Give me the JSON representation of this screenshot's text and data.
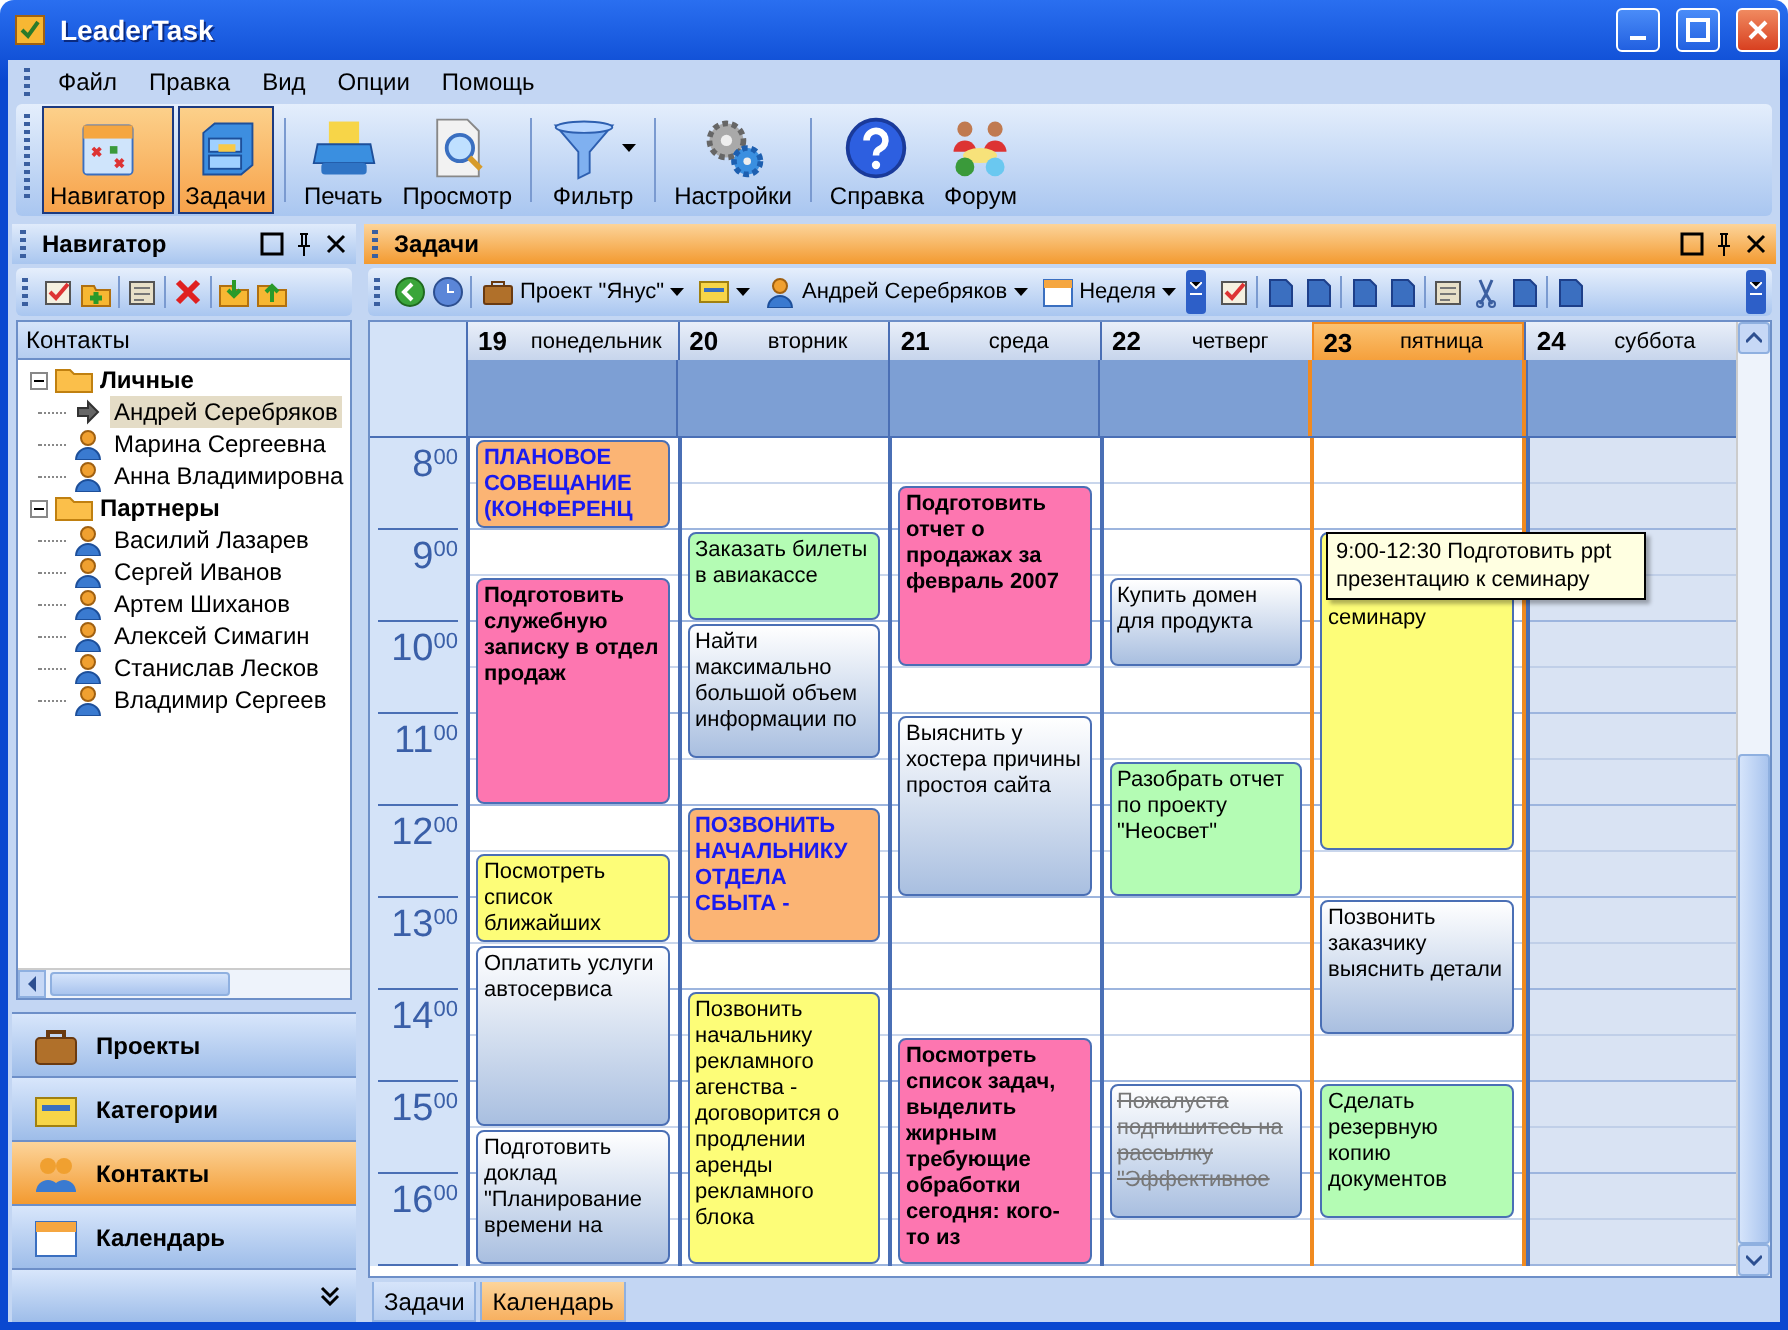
{
  "window": {
    "title": "LeaderTask"
  },
  "menu": [
    "Файл",
    "Правка",
    "Вид",
    "Опции",
    "Помощь"
  ],
  "toolbar": [
    {
      "label": "Навигатор",
      "selected": true,
      "dropdown": false
    },
    {
      "label": "Задачи",
      "selected": true,
      "dropdown": false
    },
    {
      "label": "Печать",
      "selected": false,
      "dropdown": false
    },
    {
      "label": "Просмотр",
      "selected": false,
      "dropdown": false
    },
    {
      "label": "Фильтр",
      "selected": false,
      "dropdown": true
    },
    {
      "label": "Настройки",
      "selected": false,
      "dropdown": false
    },
    {
      "label": "Справка",
      "selected": false,
      "dropdown": false
    },
    {
      "label": "Форум",
      "selected": false,
      "dropdown": false
    }
  ],
  "navigator": {
    "title": "Навигатор",
    "tree_header": "Контакты",
    "tree": [
      {
        "label": "Личные",
        "expanded": true,
        "children": [
          {
            "label": "Андрей Серебряков",
            "selected": true
          },
          {
            "label": "Марина Сергеевна",
            "selected": false
          },
          {
            "label": "Анна Владимировна",
            "selected": false
          }
        ]
      },
      {
        "label": "Партнеры",
        "expanded": true,
        "children": [
          {
            "label": "Василий Лазарев",
            "selected": false
          },
          {
            "label": "Сергей Иванов",
            "selected": false
          },
          {
            "label": "Артем Шиханов",
            "selected": false
          },
          {
            "label": "Алексей Симагин",
            "selected": false
          },
          {
            "label": "Станислав Лесков",
            "selected": false
          },
          {
            "label": "Владимир Сергеев",
            "selected": false
          }
        ]
      }
    ],
    "sections": [
      {
        "label": "Проекты",
        "selected": false
      },
      {
        "label": "Категории",
        "selected": false
      },
      {
        "label": "Контакты",
        "selected": true
      },
      {
        "label": "Календарь",
        "selected": false
      }
    ]
  },
  "tasks": {
    "title": "Задачи",
    "filters": [
      {
        "label": "Проект \"Янус\""
      },
      {
        "label": "Андрей Серебряков"
      },
      {
        "label": "Неделя"
      }
    ],
    "calendar": {
      "hours": [
        {
          "hour": "8",
          "minutes": "00"
        },
        {
          "hour": "9",
          "minutes": "00"
        },
        {
          "hour": "10",
          "minutes": "00"
        },
        {
          "hour": "11",
          "minutes": "00"
        },
        {
          "hour": "12",
          "minutes": "00"
        },
        {
          "hour": "13",
          "minutes": "00"
        },
        {
          "hour": "14",
          "minutes": "00"
        },
        {
          "hour": "15",
          "minutes": "00"
        },
        {
          "hour": "16",
          "minutes": "00"
        }
      ],
      "days": [
        {
          "date": "19",
          "weekday": "понедельник",
          "selected": false,
          "weekend": false,
          "slots": [
            {
              "kind": "event",
              "text": "ПЛАНОВОЕ СОВЕЩАНИЕ (КОНФЕРЕНЦ",
              "color": "#fbb474",
              "bold": true,
              "highlight": true,
              "done": false
            },
            {
              "kind": "continued"
            },
            {
              "kind": "free"
            },
            {
              "kind": "event",
              "text": "Подготовить служебную записку в отдел продаж",
              "color": "#fd76b0",
              "bold": true,
              "highlight": false,
              "done": false
            },
            {
              "kind": "continued"
            },
            {
              "kind": "continued"
            },
            {
              "kind": "continued"
            },
            {
              "kind": "continued"
            },
            {
              "kind": "free"
            },
            {
              "kind": "event",
              "text": "Посмотреть список ближайших",
              "color": "#fdfd78",
              "bold": false,
              "highlight": false,
              "done": false
            },
            {
              "kind": "continued"
            },
            {
              "kind": "event",
              "text": "Оплатить услуги автосервиса",
              "bold": false,
              "highlight": false,
              "done": false
            },
            {
              "kind": "continued"
            },
            {
              "kind": "continued"
            },
            {
              "kind": "continued"
            },
            {
              "kind": "event",
              "text": "Подготовить доклад \"Планирование времени на",
              "bold": false,
              "highlight": false,
              "done": false
            },
            {
              "kind": "continued"
            },
            {
              "kind": "continued"
            }
          ]
        },
        {
          "date": "20",
          "weekday": "вторник",
          "selected": false,
          "weekend": false,
          "slots": [
            {
              "kind": "free"
            },
            {
              "kind": "free"
            },
            {
              "kind": "event",
              "text": "Заказать билеты в авиакассе",
              "color": "#b4fcb4",
              "bold": false,
              "highlight": false,
              "done": false
            },
            {
              "kind": "continued"
            },
            {
              "kind": "event",
              "text": "Найти максимально большой объем информации по",
              "bold": false,
              "highlight": false,
              "done": false
            },
            {
              "kind": "continued"
            },
            {
              "kind": "continued"
            },
            {
              "kind": "free"
            },
            {
              "kind": "event",
              "text": "ПОЗВОНИТЬ НАЧАЛЬНИКУ ОТДЕЛА СБЫТА -",
              "color": "#fbb474",
              "bold": true,
              "highlight": true,
              "done": false
            },
            {
              "kind": "continued"
            },
            {
              "kind": "continued"
            },
            {
              "kind": "free"
            },
            {
              "kind": "event",
              "text": "Позвонить начальнику рекламного агенства - договорится о продлении аренды рекламного блока",
              "color": "#fdfd78",
              "bold": false,
              "highlight": false,
              "done": false
            },
            {
              "kind": "continued"
            },
            {
              "kind": "continued"
            },
            {
              "kind": "continued"
            },
            {
              "kind": "continued"
            },
            {
              "kind": "continued"
            }
          ]
        },
        {
          "date": "21",
          "weekday": "среда",
          "selected": false,
          "weekend": false,
          "slots": [
            {
              "kind": "free"
            },
            {
              "kind": "event",
              "text": "Подготовить отчет о продажах за февраль 2007",
              "color": "#fd76b0",
              "bold": true,
              "highlight": false,
              "done": false
            },
            {
              "kind": "continued"
            },
            {
              "kind": "continued"
            },
            {
              "kind": "continued"
            },
            {
              "kind": "free"
            },
            {
              "kind": "event",
              "text": "Выяснить у хостера причины простоя сайта",
              "bold": false,
              "highlight": false,
              "done": false
            },
            {
              "kind": "continued"
            },
            {
              "kind": "continued"
            },
            {
              "kind": "continued"
            },
            {
              "kind": "free"
            },
            {
              "kind": "free"
            },
            {
              "kind": "free"
            },
            {
              "kind": "event",
              "text": "Посмотреть список задач, выделить жирным требующие обработки сегодня: кого-то из",
              "color": "#fd76b0",
              "bold": true,
              "highlight": false,
              "done": false
            },
            {
              "kind": "continued"
            },
            {
              "kind": "continued"
            },
            {
              "kind": "continued"
            },
            {
              "kind": "continued"
            }
          ]
        },
        {
          "date": "22",
          "weekday": "четверг",
          "selected": false,
          "weekend": false,
          "slots": [
            {
              "kind": "free"
            },
            {
              "kind": "free"
            },
            {
              "kind": "free"
            },
            {
              "kind": "event",
              "text": "Купить домен для продукта",
              "bold": false,
              "highlight": false,
              "done": false
            },
            {
              "kind": "continued"
            },
            {
              "kind": "free"
            },
            {
              "kind": "free"
            },
            {
              "kind": "event",
              "text": "Разобрать отчет по проекту \"Неосвет\"",
              "color": "#b4fcb4",
              "bold": false,
              "highlight": false,
              "done": false
            },
            {
              "kind": "continued"
            },
            {
              "kind": "continued"
            },
            {
              "kind": "free"
            },
            {
              "kind": "free"
            },
            {
              "kind": "free"
            },
            {
              "kind": "free"
            },
            {
              "kind": "event",
              "text": "Пожалуста подпишитесь на рассылку \"Эффективное",
              "bold": false,
              "highlight": false,
              "done": true
            },
            {
              "kind": "continued"
            },
            {
              "kind": "continued"
            },
            {
              "kind": "free"
            }
          ]
        },
        {
          "date": "23",
          "weekday": "пятница",
          "selected": true,
          "weekend": false,
          "slots": [
            {
              "kind": "free"
            },
            {
              "kind": "free"
            },
            {
              "kind": "event",
              "text": "семинару",
              "color": "#fdfd78",
              "bold": false,
              "highlight": false,
              "done": false,
              "tooltip": "9:00-12:30 Подготовить ppt презентацию к семинару"
            },
            {
              "kind": "continued"
            },
            {
              "kind": "continued"
            },
            {
              "kind": "continued"
            },
            {
              "kind": "continued"
            },
            {
              "kind": "continued"
            },
            {
              "kind": "continued"
            },
            {
              "kind": "free"
            },
            {
              "kind": "event",
              "text": "Позвонить заказчику выяснить детали",
              "bold": false,
              "highlight": false,
              "done": false
            },
            {
              "kind": "continued"
            },
            {
              "kind": "continued"
            },
            {
              "kind": "free"
            },
            {
              "kind": "event",
              "text": "Сделать резервную копию документов",
              "color": "#b4fcb4",
              "bold": false,
              "highlight": false,
              "done": false
            },
            {
              "kind": "continued"
            },
            {
              "kind": "continued"
            },
            {
              "kind": "free"
            }
          ]
        },
        {
          "date": "24",
          "weekday": "суббота",
          "selected": false,
          "weekend": true,
          "slots": [
            {
              "kind": "free"
            },
            {
              "kind": "free"
            },
            {
              "kind": "free"
            },
            {
              "kind": "free"
            },
            {
              "kind": "free"
            },
            {
              "kind": "free"
            },
            {
              "kind": "free"
            },
            {
              "kind": "free"
            },
            {
              "kind": "free"
            },
            {
              "kind": "free"
            },
            {
              "kind": "free"
            },
            {
              "kind": "free"
            },
            {
              "kind": "free"
            },
            {
              "kind": "free"
            },
            {
              "kind": "free"
            },
            {
              "kind": "free"
            },
            {
              "kind": "free"
            },
            {
              "kind": "free"
            }
          ]
        }
      ]
    }
  },
  "bottom_tabs": [
    {
      "label": "Задачи",
      "selected": false
    },
    {
      "label": "Календарь",
      "selected": true
    }
  ]
}
